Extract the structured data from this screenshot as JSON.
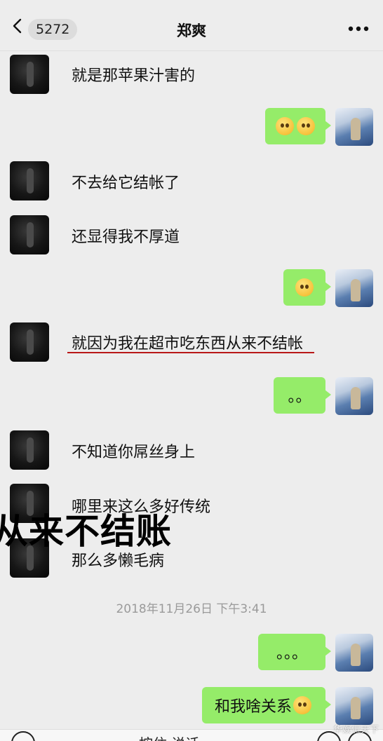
{
  "header": {
    "back_badge": "5272",
    "title": "郑爽"
  },
  "messages": [
    {
      "side": "left",
      "text": "就是那苹果汁害的"
    },
    {
      "side": "right",
      "emoji": "pleading-face x2"
    },
    {
      "side": "left",
      "text": "不去给它结帐了"
    },
    {
      "side": "left",
      "text": "还显得我不厚道"
    },
    {
      "side": "right",
      "emoji": "rolling-laughing-face"
    },
    {
      "side": "left",
      "text": "就因为我在超市吃东西从来不结帐"
    },
    {
      "side": "right",
      "text": "。。"
    },
    {
      "side": "left",
      "text": "不知道你屌丝身上"
    },
    {
      "side": "left",
      "text": "哪里来这么多好传统"
    },
    {
      "side": "left",
      "text": "那么多懒毛病"
    },
    {
      "side": "right",
      "text": "。。。"
    },
    {
      "side": "right",
      "text": "和我啥关系",
      "emoji": "rolling-laughing-face"
    }
  ],
  "caption_overlay": "从来不结账",
  "timestamp": "2018年11月26日 下午3:41",
  "footer": {
    "hold_to_talk": "按住 说话"
  },
  "watermark": "华娱侃天下",
  "colors": {
    "background": "#ededed",
    "sent_bubble": "#95ec69",
    "underline": "#b81818"
  }
}
